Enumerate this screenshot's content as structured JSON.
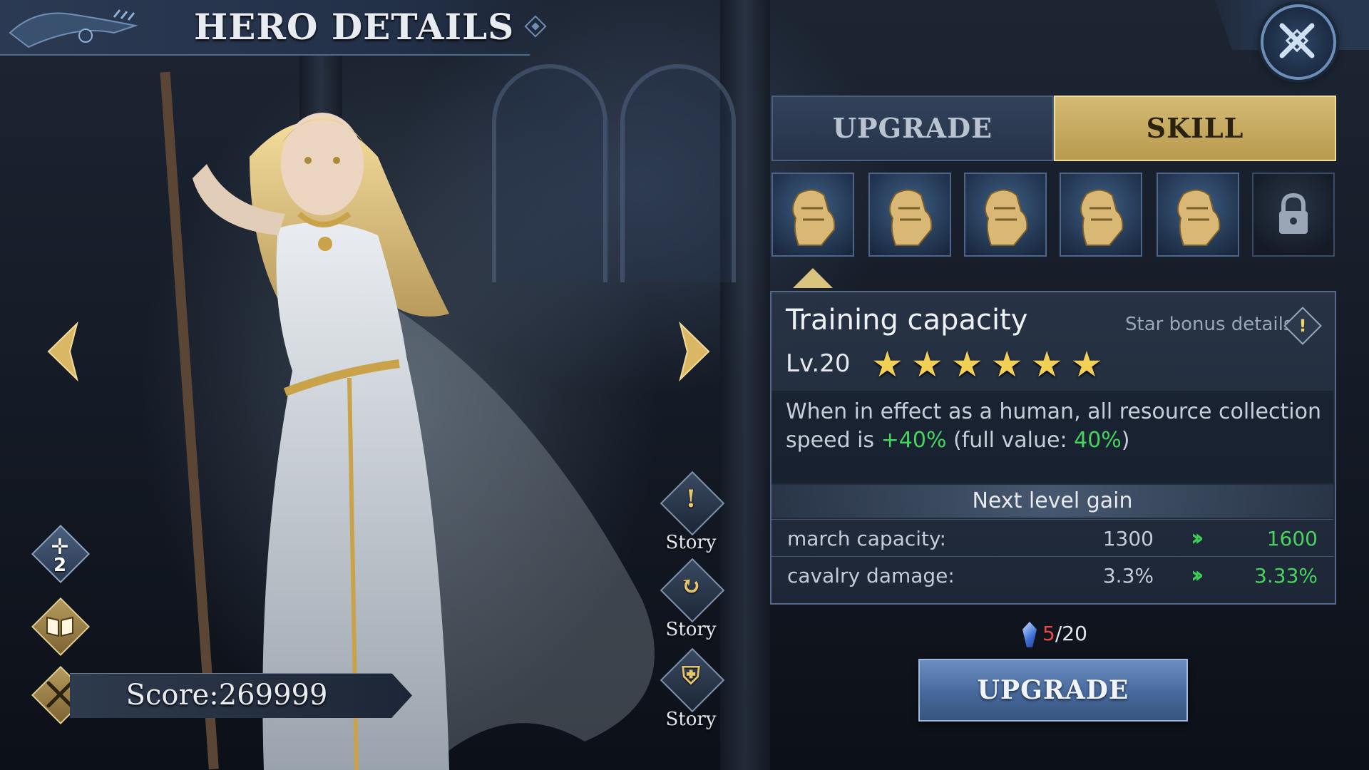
{
  "header": {
    "title": "HERO DETAILS"
  },
  "tabs": [
    {
      "label": "UPGRADE",
      "active": false
    },
    {
      "label": "SKILL",
      "active": true
    }
  ],
  "skill_slots": [
    {
      "icon": "armored-knight-icon",
      "locked": false
    },
    {
      "icon": "armored-knight-icon",
      "locked": false
    },
    {
      "icon": "armored-knight-icon",
      "locked": false
    },
    {
      "icon": "armored-knight-icon",
      "locked": false
    },
    {
      "icon": "armored-knight-icon",
      "locked": false
    },
    {
      "icon": "lock-icon",
      "locked": true
    }
  ],
  "skill": {
    "name": "Training capacity",
    "star_bonus_label": "Star bonus details",
    "level": "Lv.20",
    "stars": 6,
    "star_glyph": "★",
    "desc_pre": "When in effect as a human,  all resource collection speed is ",
    "desc_value": "+40%",
    "desc_mid": " (full value: ",
    "desc_full": "40%",
    "desc_post": ")"
  },
  "next_level": {
    "title": "Next level gain",
    "rows": [
      {
        "key": "march capacity:",
        "current": "1300",
        "next": "1600"
      },
      {
        "key": "cavalry damage:",
        "current": "3.3%",
        "next": "3.33%"
      }
    ]
  },
  "cost": {
    "have": "5",
    "sep": "/",
    "need": "20"
  },
  "upgrade_button": "UPGRADE",
  "story_buttons": [
    {
      "label": "Story",
      "icon": "!"
    },
    {
      "label": "Story",
      "icon": "↻"
    },
    {
      "label": "Story",
      "icon": "⛨"
    }
  ],
  "left_badges": {
    "rank_number": "2"
  },
  "score": "Score:269999",
  "colors": {
    "gold": "#d4bb73",
    "green": "#46d35e",
    "red": "#e94a4a",
    "panel": "#283446"
  }
}
